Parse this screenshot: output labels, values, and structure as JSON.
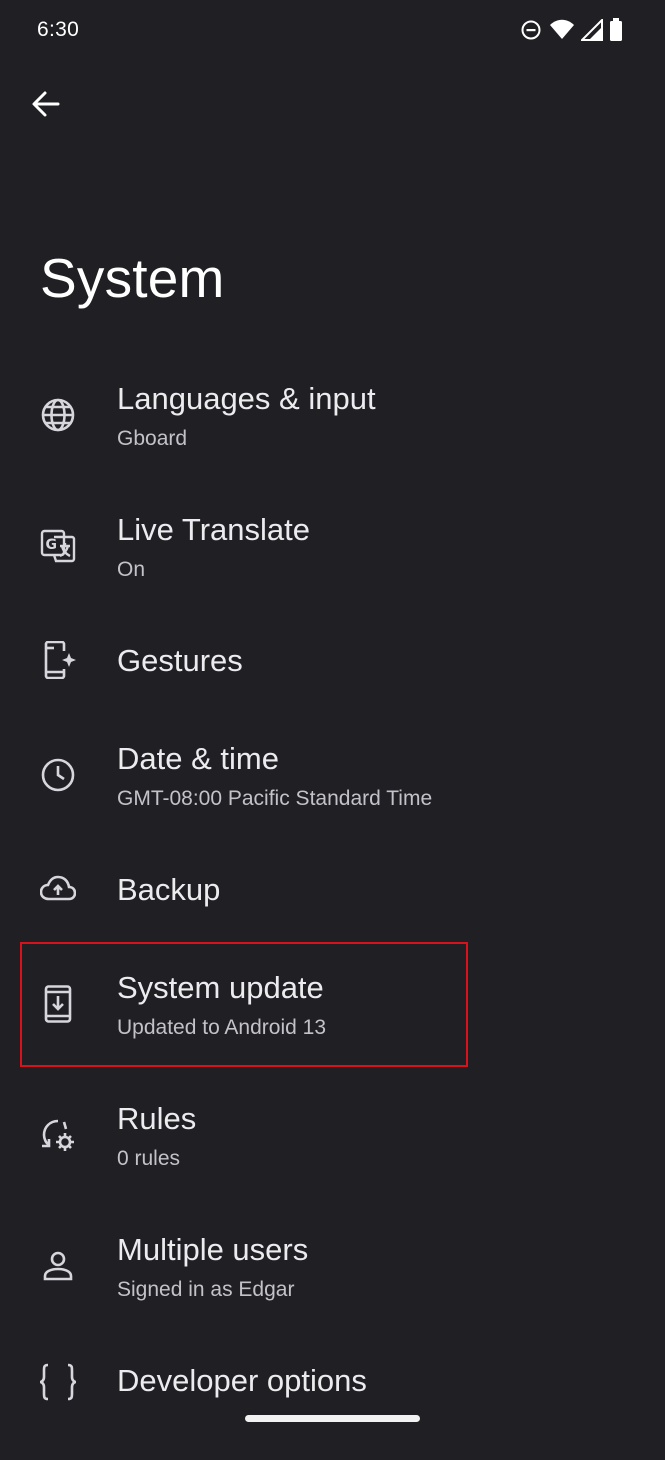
{
  "status_bar": {
    "time": "6:30",
    "icons": [
      "do-not-disturb-icon",
      "wifi-icon",
      "cell-signal-icon",
      "battery-icon"
    ]
  },
  "header": {
    "back_icon": "arrow-back-icon",
    "title": "System"
  },
  "settings": [
    {
      "id": "languages",
      "icon": "globe-icon",
      "title": "Languages & input",
      "subtitle": "Gboard"
    },
    {
      "id": "live-translate",
      "icon": "translate-icon",
      "title": "Live Translate",
      "subtitle": "On"
    },
    {
      "id": "gestures",
      "icon": "gestures-icon",
      "title": "Gestures",
      "subtitle": ""
    },
    {
      "id": "date-time",
      "icon": "clock-icon",
      "title": "Date & time",
      "subtitle": "GMT-08:00 Pacific Standard Time"
    },
    {
      "id": "backup",
      "icon": "cloud-upload-icon",
      "title": "Backup",
      "subtitle": ""
    },
    {
      "id": "system-update",
      "icon": "system-update-icon",
      "title": "System update",
      "subtitle": "Updated to Android 13"
    },
    {
      "id": "rules",
      "icon": "rules-icon",
      "title": "Rules",
      "subtitle": "0 rules"
    },
    {
      "id": "multiple-users",
      "icon": "person-icon",
      "title": "Multiple users",
      "subtitle": "Signed in as Edgar"
    },
    {
      "id": "developer-options",
      "icon": "braces-icon",
      "title": "Developer options",
      "subtitle": ""
    }
  ],
  "colors": {
    "background": "#1f1f24",
    "highlight": "#d8121d"
  }
}
